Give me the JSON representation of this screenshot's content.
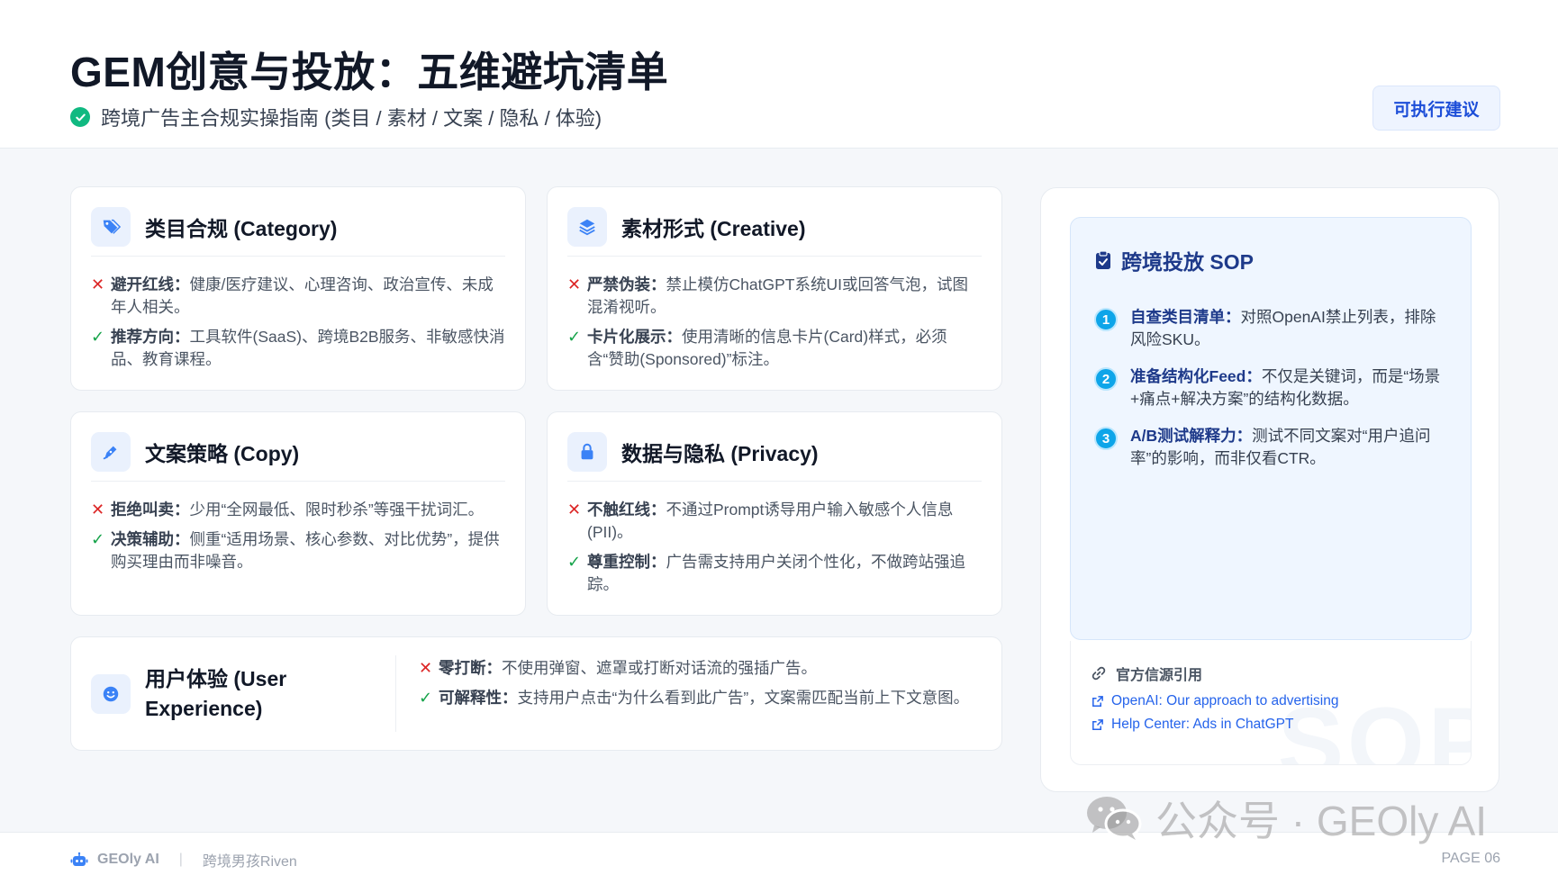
{
  "header": {
    "title": "GEM创意与投放：五维避坑清单",
    "subtitle": "跨境广告主合规实操指南 (类目 / 素材 / 文案 / 隐私 / 体验)",
    "action_badge": "可执行建议"
  },
  "cards": {
    "category": {
      "title": "类目合规 (Category)",
      "icon": "tag-icon",
      "items": [
        {
          "type": "x",
          "label": "避开红线：",
          "text": "健康/医疗建议、心理咨询、政治宣传、未成年人相关。"
        },
        {
          "type": "ok",
          "label": "推荐方向：",
          "text": "工具软件(SaaS)、跨境B2B服务、非敏感快消品、教育课程。"
        }
      ]
    },
    "creative": {
      "title": "素材形式 (Creative)",
      "icon": "layers-icon",
      "items": [
        {
          "type": "x",
          "label": "严禁伪装：",
          "text": "禁止模仿ChatGPT系统UI或回答气泡，试图混淆视听。"
        },
        {
          "type": "ok",
          "label": "卡片化展示：",
          "text": "使用清晰的信息卡片(Card)样式，必须含“赞助(Sponsored)”标注。"
        }
      ]
    },
    "copy": {
      "title": "文案策略 (Copy)",
      "icon": "pen-icon",
      "items": [
        {
          "type": "x",
          "label": "拒绝叫卖：",
          "text": "少用“全网最低、限时秒杀”等强干扰词汇。"
        },
        {
          "type": "ok",
          "label": "决策辅助：",
          "text": "侧重“适用场景、核心参数、对比优势”，提供购买理由而非噪音。"
        }
      ]
    },
    "privacy": {
      "title": "数据与隐私 (Privacy)",
      "icon": "lock-icon",
      "items": [
        {
          "type": "x",
          "label": "不触红线：",
          "text": "不通过Prompt诱导用户输入敏感个人信息(PII)。"
        },
        {
          "type": "ok",
          "label": "尊重控制：",
          "text": "广告需支持用户关闭个性化，不做跨站强追踪。"
        }
      ]
    },
    "ux": {
      "title_line1": "用户体验 (User",
      "title_line2": "Experience)",
      "icon": "smile-icon",
      "items": [
        {
          "type": "x",
          "label": "零打断：",
          "text": "不使用弹窗、遮罩或打断对话流的强插广告。"
        },
        {
          "type": "ok",
          "label": "可解释性：",
          "text": "支持用户点击“为什么看到此广告”，文案需匹配当前上下文意图。"
        }
      ]
    }
  },
  "marks": {
    "x": "✕",
    "ok": "✓"
  },
  "sop": {
    "title": "跨境投放 SOP",
    "steps": [
      {
        "num": "1",
        "label": "自查类目清单：",
        "text": "对照OpenAI禁止列表，排除风险SKU。"
      },
      {
        "num": "2",
        "label": "准备结构化Feed：",
        "text": "不仅是关键词，而是“场景+痛点+解决方案”的结构化数据。"
      },
      {
        "num": "3",
        "label": "A/B测试解释力：",
        "text": "测试不同文案对“用户追问率”的影响，而非仅看CTR。"
      }
    ]
  },
  "sources": {
    "title": "官方信源引用",
    "links": [
      "OpenAI: Our approach to advertising",
      "Help Center: Ads in ChatGPT"
    ],
    "watermark": "SOP"
  },
  "footer": {
    "brand": "GEOly AI",
    "separator": "|",
    "author": "跨境男孩Riven",
    "page": "PAGE 06"
  },
  "overlay": {
    "wechat_watermark": "公众号 · GEOly AI"
  },
  "colors": {
    "accent": "#1d4ed8",
    "success": "#16a34a",
    "danger": "#dc2626",
    "step": "#0ea5e9"
  }
}
